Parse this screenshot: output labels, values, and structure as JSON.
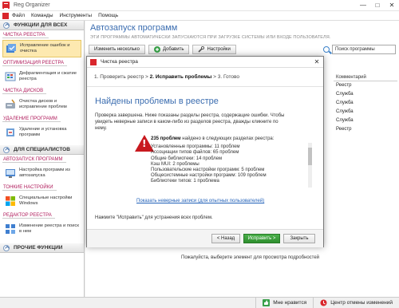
{
  "app": {
    "title": "Reg Organizer",
    "win_buttons": [
      "—",
      "□",
      "✕"
    ]
  },
  "menu": [
    "Файл",
    "Команды",
    "Инструменты",
    "Помощь"
  ],
  "sidebar": {
    "header_all": "ФУНКЦИИ ДЛЯ ВСЕХ",
    "groups_all": [
      {
        "title": "ЧИСТКА РЕЕСТРА",
        "item": "Исправление ошибок и очистка",
        "active": true
      },
      {
        "title": "ОПТИМИЗАЦИЯ РЕЕСТРА",
        "item": "Дефрагментация и сжатие реестра"
      },
      {
        "title": "ЧИСТКА ДИСКОВ",
        "item": "Очистка дисков и исправление проблем"
      },
      {
        "title": "УДАЛЕНИЕ ПРОГРАММ",
        "item": "Удаление и установка программ"
      }
    ],
    "header_spec": "ДЛЯ СПЕЦИАЛИСТОВ",
    "groups_spec": [
      {
        "title": "АВТОЗАПУСК ПРОГРАММ",
        "item": "Настройка программ из автозапуска"
      },
      {
        "title": "ТОНКИЕ НАСТРОЙКИ",
        "item": "Специальные настройки Windows"
      },
      {
        "title": "РЕДАКТОР РЕЕСТРА",
        "item": "Изменение реестра и поиск в нем"
      }
    ],
    "header_other": "ПРОЧИЕ ФУНКЦИИ"
  },
  "main": {
    "title": "Автозапуск программ",
    "subtitle": "ЭТИ ПРОГРАММЫ АВТОМАТИЧЕСКИ ЗАПУСКАЮТСЯ ПРИ ЗАГРУЗКЕ СИСТЕМЫ ИЛИ ВХОДЕ ПОЛЬЗОВАТЕЛЯ.",
    "toolbar": {
      "change_many": "Изменить несколько",
      "add": "Добавить",
      "settings": "Настройки"
    },
    "search_placeholder": "Поиск программы",
    "column_comment": "Комментарий",
    "comments": [
      "Реестр",
      "Служба",
      "Служба",
      "Служба",
      "Служба",
      "Реестр"
    ],
    "detail_hint": "Пожалуйста, выберите элемент для просмотра подробностей"
  },
  "status": {
    "like": "Мне нравится",
    "changes": "Центр отмены изменений"
  },
  "dialog": {
    "title": "Чистка реестра",
    "step1": "1. Проверить реестр",
    "step2": "2. Исправить проблемы",
    "step3": "3. Готово",
    "heading": "Найдены проблемы в реестре",
    "intro": "Проверка завершена. Ниже показаны разделы реестра, содержащие ошибки. Чтобы увидеть неверные записи в каком-либо из разделов реестра, дважды кликните по нему.",
    "summary_count": "235 проблем",
    "summary_rest": "найдено в следующих разделах реестра:",
    "problems": [
      "Установленные программы: 11 проблем",
      "Ассоциации типов файлов: 65 проблем",
      "Общие библиотеки: 14 проблем",
      "Кэш MUI: 2 проблемы",
      "Пользовательские настройки программ: 5 проблем",
      "Общесистемные настройки программ: 109 проблем",
      "Библиотеки типов: 1 проблема"
    ],
    "link": "Показать неверные записи (для опытных пользователей)",
    "footer": "Нажмите \"Исправить\" для устранения всех проблем.",
    "btn_back": "< Назад",
    "btn_fix": "Исправить >",
    "btn_close": "Закрыть"
  }
}
